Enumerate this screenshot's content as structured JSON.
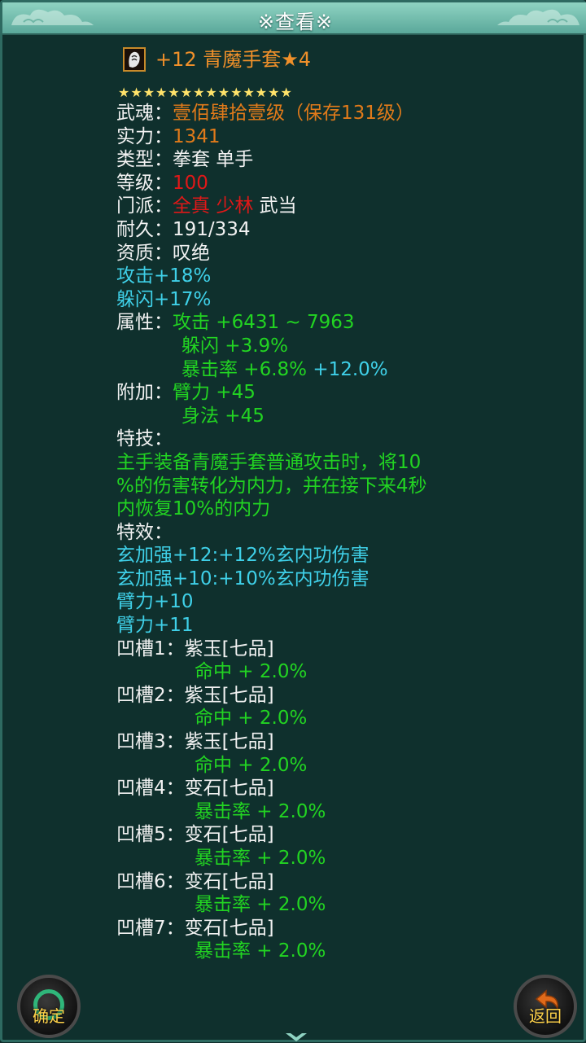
{
  "window": {
    "title": "※查看※"
  },
  "item": {
    "name": "+12 青魔手套★4",
    "stars": "★★★★★★★★★★★★★★",
    "icon": "glove-item-icon"
  },
  "attributes": [
    {
      "label": "武魂：",
      "value": "壹佰肆拾壹级（保存131级）"
    },
    {
      "label": "实力：",
      "value": "1341"
    },
    {
      "label": "类型：",
      "value": "拳套 单手"
    },
    {
      "label": "等级：",
      "value": "100"
    },
    {
      "label": "门派：",
      "values": [
        "全真",
        "少林",
        "武当"
      ]
    },
    {
      "label": "耐久：",
      "value": "191/334"
    },
    {
      "label": "资质：",
      "value": "叹绝"
    }
  ],
  "bonuses": [
    "攻击+18%",
    "躲闪+17%"
  ],
  "properties": {
    "label": "属性：",
    "lines": [
      "攻击 +6431 ~ 7963",
      "躲闪 +3.9%",
      "暴击率 +6.8%"
    ],
    "extra": "+12.0%"
  },
  "additional": {
    "label": "附加：",
    "lines": [
      "臂力 +45",
      "身法 +45"
    ]
  },
  "skill": {
    "label": "特技：",
    "lines": [
      "主手装备青魔手套普通攻击时，将10",
      "%的伤害转化为内力，并在接下来4秒",
      "内恢复10%的内力"
    ]
  },
  "effects": {
    "label": "特效：",
    "lines": [
      "玄加强+12:+12%玄内功伤害",
      "玄加强+10:+10%玄内功伤害",
      "臂力+10",
      "臂力+11"
    ]
  },
  "slots": [
    {
      "label": "凹槽1：",
      "gem": "紫玉[七品]",
      "effect": "命中 + 2.0%"
    },
    {
      "label": "凹槽2：",
      "gem": "紫玉[七品]",
      "effect": "命中 + 2.0%"
    },
    {
      "label": "凹槽3：",
      "gem": "紫玉[七品]",
      "effect": "命中 + 2.0%"
    },
    {
      "label": "凹槽4：",
      "gem": "变石[七品]",
      "effect": "暴击率 + 2.0%"
    },
    {
      "label": "凹槽5：",
      "gem": "变石[七品]",
      "effect": "暴击率 + 2.0%"
    },
    {
      "label": "凹槽6：",
      "gem": "变石[七品]",
      "effect": "暴击率 + 2.0%"
    },
    {
      "label": "凹槽7：",
      "gem": "变石[七品]",
      "effect": "暴击率 + 2.0%"
    }
  ],
  "buttons": {
    "confirm_label": "确定",
    "back_label": "返回"
  },
  "colors": {
    "background": "#0f302d",
    "title_bar": "#8fd3c2",
    "item_name": "#f0902a",
    "value_orange": "#e07a1a",
    "value_red": "#e01818",
    "bonus_cyan": "#3fd0e8",
    "property_green": "#22d422"
  }
}
